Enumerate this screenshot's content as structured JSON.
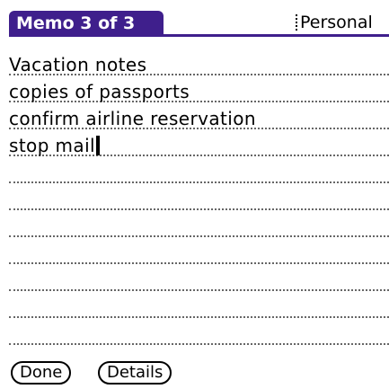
{
  "title_bar": {
    "title": "Memo 3 of 3",
    "category": "Personal"
  },
  "memo": {
    "lines": [
      "Vacation notes",
      "copies of passports",
      "confirm airline reservation",
      "stop mail"
    ]
  },
  "buttons": {
    "done": "Done",
    "details": "Details"
  },
  "colors": {
    "title_background": "#3f1f8c",
    "title_text": "#ffffff",
    "page_background": "#ffffff"
  }
}
